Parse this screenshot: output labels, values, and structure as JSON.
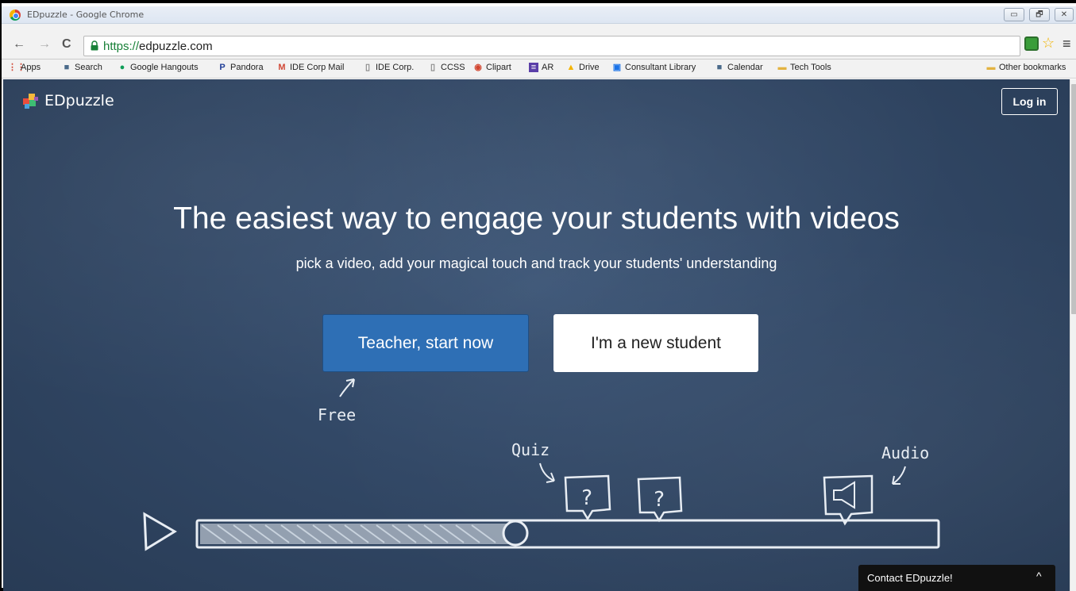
{
  "window": {
    "title": "EDpuzzle - Google Chrome",
    "controls": [
      "▭",
      "🗗",
      "✕"
    ]
  },
  "toolbar": {
    "back": "←",
    "forward": "→",
    "reload": "C",
    "url_scheme": "https://",
    "url_host": "edpuzzle.com",
    "star": "☆",
    "menu": "≡"
  },
  "bookmarks": {
    "items": [
      {
        "label": "Apps",
        "icon": "apps-grid-icon"
      },
      {
        "label": "Search",
        "icon": "ide-logo-icon"
      },
      {
        "label": "Google Hangouts",
        "icon": "hangouts-icon"
      },
      {
        "label": "Pandora",
        "icon": "pandora-icon"
      },
      {
        "label": "IDE Corp Mail",
        "icon": "gmail-icon"
      },
      {
        "label": "IDE Corp.",
        "icon": "page-icon"
      },
      {
        "label": "CCSS",
        "icon": "page-icon"
      },
      {
        "label": "Clipart",
        "icon": "clipart-icon"
      },
      {
        "label": "AR",
        "icon": "list-icon"
      },
      {
        "label": "Drive",
        "icon": "drive-icon"
      },
      {
        "label": "Consultant Library",
        "icon": "calendar-box-icon"
      },
      {
        "label": "Calendar",
        "icon": "ide-logo-icon"
      },
      {
        "label": "Tech Tools",
        "icon": "folder-icon"
      }
    ],
    "other": "Other bookmarks"
  },
  "page": {
    "brand": "EDpuzzle",
    "login": "Log in",
    "headline": "The easiest way to engage your students with videos",
    "subline": "pick a video, add your magical touch and track your students' understanding",
    "teacher_button": "Teacher, start now",
    "student_button": "I'm a new student",
    "chalk_free": "Free",
    "chalk_quiz": "Quiz",
    "chalk_audio": "Audio",
    "contact": "Contact EDpuzzle!",
    "contact_chevron": "^"
  }
}
